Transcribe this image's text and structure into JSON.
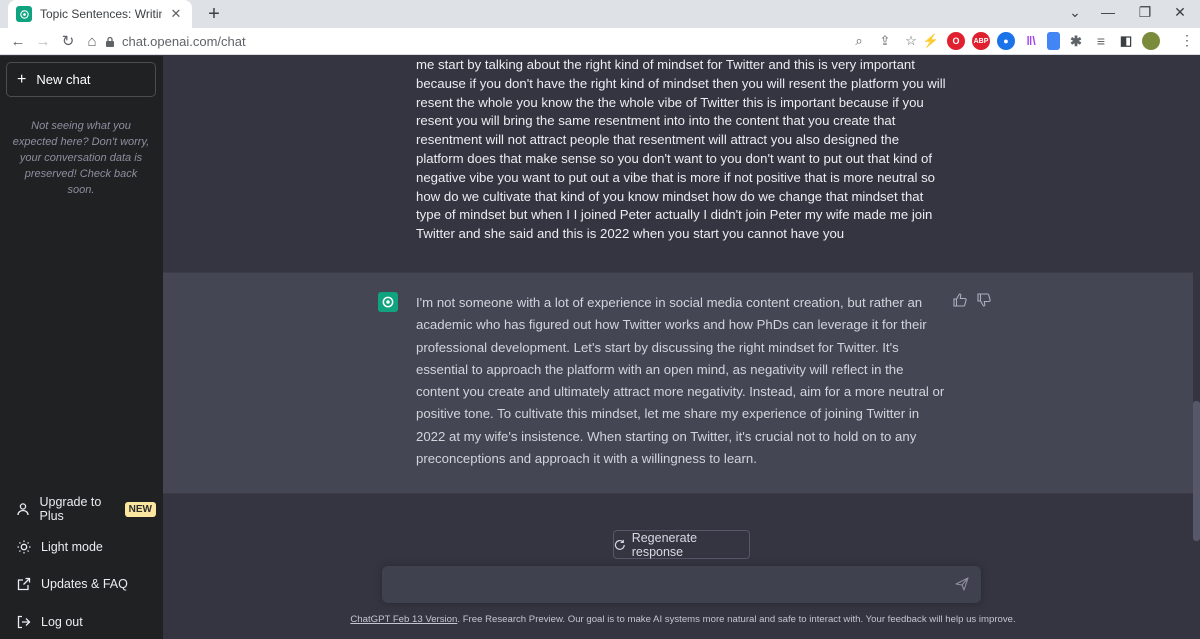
{
  "browser": {
    "tab_title": "Topic Sentences: Writing Tips.",
    "url": "chat.openai.com/chat",
    "new_tab_icon": "plus-icon",
    "extensions": [
      {
        "name": "lightning-icon",
        "color": "#3c4043",
        "label": "⚡"
      },
      {
        "name": "opera-icon",
        "color": "#e0202e",
        "label": "O"
      },
      {
        "name": "adblock-icon",
        "color": "#e0202e",
        "label": "ABP"
      },
      {
        "name": "extension-blue-icon",
        "color": "#1a73e8",
        "label": "●"
      },
      {
        "name": "library-icon",
        "color": "#a142f4",
        "label": "||\\"
      },
      {
        "name": "docs-icon",
        "color": "#4285f4",
        "label": ""
      },
      {
        "name": "puzzle-icon",
        "color": "#5f6368",
        "label": "✱"
      },
      {
        "name": "media-list-icon",
        "color": "#5f6368",
        "label": "≡"
      },
      {
        "name": "sidepanel-icon",
        "color": "#5f6368",
        "label": "▮"
      }
    ]
  },
  "sidebar": {
    "new_chat_label": "New chat",
    "note": "Not seeing what you expected here? Don't worry, your conversation data is preserved! Check back soon.",
    "items": [
      {
        "label": "Upgrade to Plus",
        "icon": "user-icon",
        "badge": "NEW"
      },
      {
        "label": "Light mode",
        "icon": "sun-icon"
      },
      {
        "label": "Updates & FAQ",
        "icon": "external-link-icon"
      },
      {
        "label": "Log out",
        "icon": "logout-icon"
      }
    ]
  },
  "conversation": {
    "user_message": "me start by talking about the right kind of mindset for Twitter and this is very important because if you don't have the right kind of mindset then you will resent the platform you will resent the whole you know the the whole vibe of Twitter this is important because if you resent you will bring the same resentment into into the content that you create that resentment will not attract people that resentment will attract you also designed the platform does that make sense so you don't want to you don't want to put out that kind of negative vibe you want to put out a vibe that is more if not positive that is more neutral so how do we cultivate that kind of you know mindset how do we change that mindset that type of mindset but when I I joined Peter actually I didn't join Peter my wife made me join Twitter and she said and this is 2022 when you start you cannot have you",
    "assistant_message": "I'm not someone with a lot of experience in social media content creation, but rather an academic who has figured out how Twitter works and how PhDs can leverage it for their professional development. Let's start by discussing the right mindset for Twitter. It's essential to approach the platform with an open mind, as negativity will reflect in the content you create and ultimately attract more negativity. Instead, aim for a more neutral or positive tone. To cultivate this mindset, let me share my experience of joining Twitter in 2022 at my wife's insistence. When starting on Twitter, it's crucial not to hold on to any preconceptions and approach it with a willingness to learn."
  },
  "composer": {
    "regenerate_label": "Regenerate response",
    "placeholder": ""
  },
  "footer": {
    "version_link": "ChatGPT Feb 13 Version",
    "text": ". Free Research Preview. Our goal is to make AI systems more natural and safe to interact with. Your feedback will help us improve."
  },
  "colors": {
    "accent": "#10a37f",
    "sidebar_bg": "#202123",
    "main_bg": "#343541",
    "assistant_bg": "#444654",
    "badge_bg": "#fae69e"
  }
}
